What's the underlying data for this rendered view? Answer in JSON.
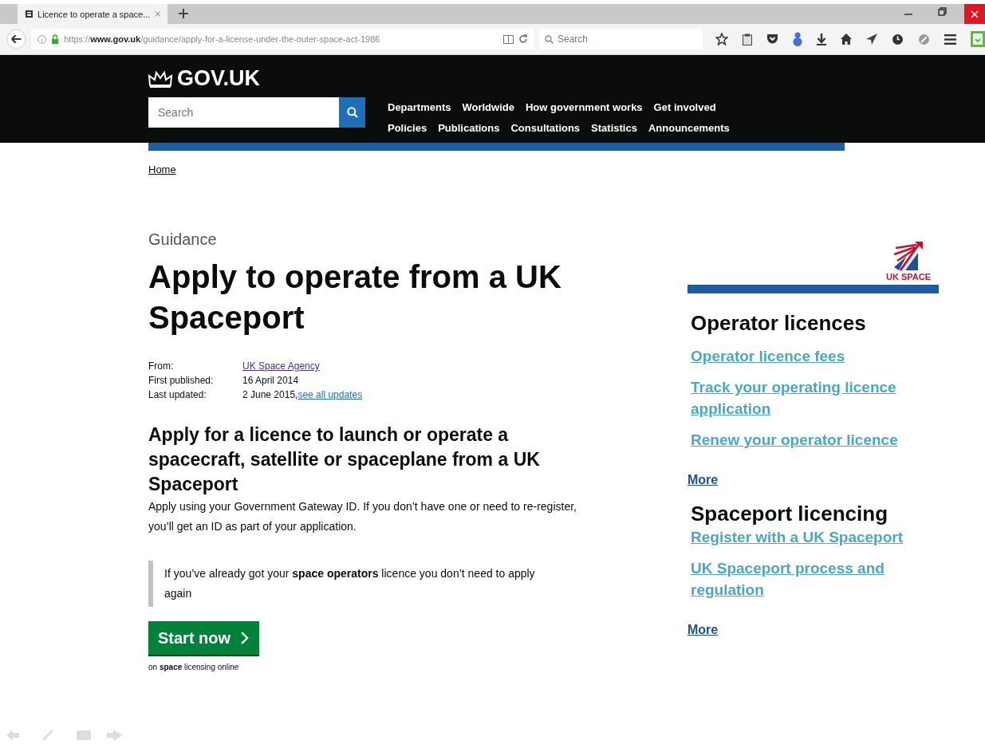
{
  "browser": {
    "tab": {
      "title": "Licence to operate a space...",
      "selected": true
    },
    "url": "https://**www.gov.uk**/guidance/apply-for-a-license-under-the-outer-space-act-1986",
    "search": {
      "placeholder": "Search"
    }
  },
  "header": {
    "logo": "GOV.UK",
    "search": {
      "placeholder": "Search"
    },
    "nav": [
      [
        "Departments",
        "Worldwide",
        "How government works",
        "Get involved"
      ],
      [
        "Policies",
        "Publications",
        "Consultations",
        "Statistics",
        "Announcements"
      ]
    ]
  },
  "breadcrumb": "Home",
  "kicker": "Guidance",
  "title": "Apply to operate from a UK Spaceport",
  "meta": [
    {
      "label": "From:",
      "link": "UK Space Agency"
    },
    {
      "label": "First published:",
      "value": "16 April 2014"
    },
    {
      "label": "Last updated:",
      "value": "2 June 2015,",
      "link": "see all updates"
    }
  ],
  "subtitle": "Apply for a licence to launch or operate a spacecraft, satellite or spaceplane from a UK Spaceport",
  "intro": "Apply using your Government Gateway ID. If you don’t have one or need to re-register, you’ll get an ID as part of your application.",
  "inset": "If you’ve already got your **space operators** licence you don’t need to apply again",
  "start_button": {
    "label": "Start now",
    "caption": "on **space** licensing online"
  },
  "sidebar": {
    "logo_text": "UK SPACE",
    "sections": [
      {
        "heading": "Operator licences",
        "links": [
          "Operator licence fees",
          "Track your operating licence application",
          "Renew your operator licence"
        ],
        "more": "More"
      },
      {
        "heading": "Spaceport licencing",
        "links": [
          "Register with a UK Spaceport",
          "UK Spaceport process and regulation"
        ],
        "more": "More"
      }
    ]
  }
}
